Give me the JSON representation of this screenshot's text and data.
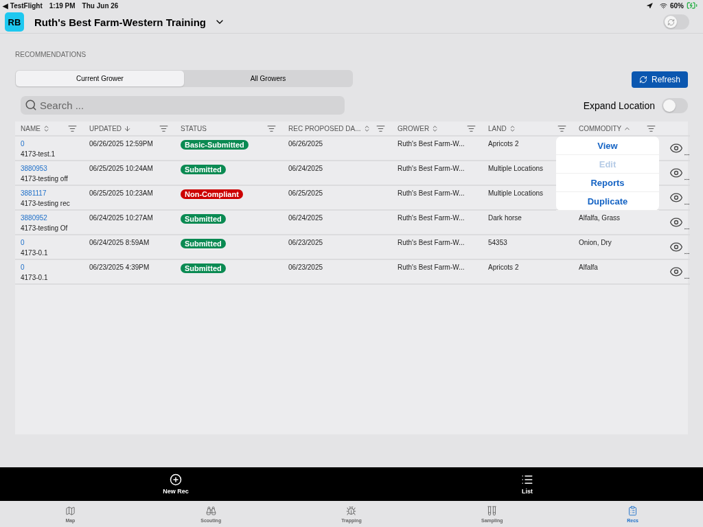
{
  "status_bar": {
    "back": "◀ TestFlight",
    "time": "1:19 PM",
    "date": "Thu Jun 26",
    "battery": "60%"
  },
  "header": {
    "avatar": "RB",
    "title": "Ruth's Best Farm-Western Training",
    "sync_toggle": {
      "on": false
    }
  },
  "section_title": "RECOMMENDATIONS",
  "segments": [
    {
      "label": "Current Grower",
      "selected": true
    },
    {
      "label": "All Growers",
      "selected": false
    }
  ],
  "refresh_button": "Refresh",
  "search": {
    "placeholder": "Search ..."
  },
  "expand_location": {
    "label": "Expand Location",
    "on": false
  },
  "table": {
    "columns": [
      {
        "label": "NAME",
        "kind": "sortable"
      },
      {
        "label": "UPDATED",
        "kind": "descending"
      },
      {
        "label": "STATUS",
        "kind": "plain"
      },
      {
        "label": "REC PROPOSED DA...",
        "kind": "sortable"
      },
      {
        "label": "GROWER",
        "kind": "sortable"
      },
      {
        "label": "LAND",
        "kind": "sortable"
      },
      {
        "label": "COMMODITY",
        "kind": "ascending"
      }
    ],
    "rows": [
      {
        "id": "0",
        "name": "4173-test.1",
        "updated": "06/26/2025 12:59PM",
        "status": {
          "label": "Basic-Submitted",
          "color": "#0a8a52"
        },
        "proposed": "06/26/2025",
        "grower": "Ruth's Best Farm-W...",
        "land": "Apricots 2"
      },
      {
        "id": "3880953",
        "name": "4173-testing off",
        "updated": "06/25/2025 10:24AM",
        "status": {
          "label": "Submitted",
          "color": "#0a8a52"
        },
        "proposed": "06/24/2025",
        "grower": "Ruth's Best Farm-W...",
        "land": "Multiple Locations"
      },
      {
        "id": "3881117",
        "name": "4173-testing rec",
        "updated": "06/25/2025 10:23AM",
        "status": {
          "label": "Non-Compliant",
          "color": "#cc0000"
        },
        "proposed": "06/25/2025",
        "grower": "Ruth's Best Farm-W...",
        "land": "Multiple Locations"
      },
      {
        "id": "3880952",
        "name": "4173-testing Of",
        "updated": "06/24/2025 10:27AM",
        "status": {
          "label": "Submitted",
          "color": "#0a8a52"
        },
        "proposed": "06/24/2025",
        "grower": "Ruth's Best Farm-W...",
        "land": "Dark horse",
        "commodity": "Alfalfa, Grass"
      },
      {
        "id": "0",
        "name": "4173-0.1",
        "updated": "06/24/2025 8:59AM",
        "status": {
          "label": "Submitted",
          "color": "#0a8a52"
        },
        "proposed": "06/23/2025",
        "grower": "Ruth's Best Farm-W...",
        "land": "54353",
        "commodity": "Onion, Dry"
      },
      {
        "id": "0",
        "name": "4173-0.1",
        "updated": "06/23/2025 4:39PM",
        "status": {
          "label": "Submitted",
          "color": "#0a8a52"
        },
        "proposed": "06/23/2025",
        "grower": "Ruth's Best Farm-W...",
        "land": "Apricots 2",
        "commodity": "Alfalfa"
      }
    ]
  },
  "popup_menu": [
    {
      "label": "View",
      "disabled": false
    },
    {
      "label": "Edit",
      "disabled": true
    },
    {
      "label": "Reports",
      "disabled": false
    },
    {
      "label": "Duplicate",
      "disabled": false
    }
  ],
  "action_bar": [
    {
      "label": "New Rec",
      "kind": "add"
    },
    {
      "label": "List",
      "kind": "list"
    }
  ],
  "tab_bar": [
    {
      "label": "Map",
      "kind": "map",
      "selected": false
    },
    {
      "label": "Scouting",
      "kind": "binoculars",
      "selected": false
    },
    {
      "label": "Trapping",
      "kind": "bug",
      "selected": false
    },
    {
      "label": "Sampling",
      "kind": "tubes",
      "selected": false
    },
    {
      "label": "Recs",
      "kind": "clipboard",
      "selected": true
    }
  ]
}
